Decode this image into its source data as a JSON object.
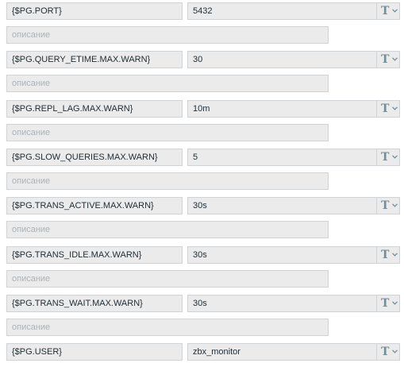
{
  "description_placeholder": "описание",
  "type_button_icon": "T",
  "colors": {
    "field_background": "#ebebeb",
    "field_border": "#cfd3d6",
    "text": "#1f2c33",
    "placeholder_text": "#acb2b6",
    "icon": "#768d99"
  },
  "macros": [
    {
      "name": "{$PG.PORT}",
      "value": "5432",
      "description": ""
    },
    {
      "name": "{$PG.QUERY_ETIME.MAX.WARN}",
      "value": "30",
      "description": ""
    },
    {
      "name": "{$PG.REPL_LAG.MAX.WARN}",
      "value": "10m",
      "description": ""
    },
    {
      "name": "{$PG.SLOW_QUERIES.MAX.WARN}",
      "value": "5",
      "description": ""
    },
    {
      "name": "{$PG.TRANS_ACTIVE.MAX.WARN}",
      "value": "30s",
      "description": ""
    },
    {
      "name": "{$PG.TRANS_IDLE.MAX.WARN}",
      "value": "30s",
      "description": ""
    },
    {
      "name": "{$PG.TRANS_WAIT.MAX.WARN}",
      "value": "30s",
      "description": ""
    },
    {
      "name": "{$PG.USER}",
      "value": "zbx_monitor"
    }
  ]
}
